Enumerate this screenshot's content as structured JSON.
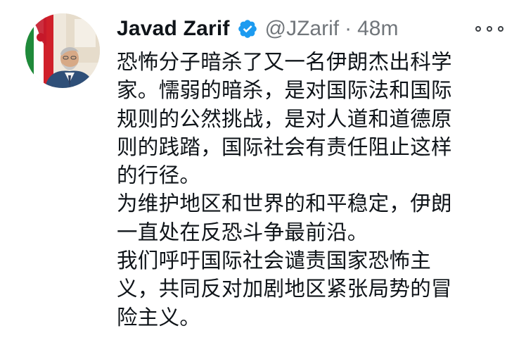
{
  "author": {
    "display_name": "Javad Zarif",
    "handle": "@JZarif",
    "separator": "·",
    "timestamp": "48m",
    "verified": true,
    "avatar_icon": "profile-photo"
  },
  "more_icon": "more-options-icon",
  "colors": {
    "text": "#0f1419",
    "secondary": "#71767b",
    "verified_blue": "#1d9bf0"
  },
  "body_lines": [
    "恐怖分子暗杀了又一名伊朗杰出科学",
    "家。懦弱的暗杀，是对国际法和国际",
    "规则的公然挑战，是对人道和道德原",
    "则的践踏，国际社会有责任阻止这样",
    "的行径。",
    "为维护地区和世界的和平稳定，伊朗",
    "一直处在反恐斗争最前沿。",
    "我们呼吁国际社会谴责国家恐怖主",
    "义，共同反对加剧地区紧张局势的冒",
    "险主义。"
  ]
}
